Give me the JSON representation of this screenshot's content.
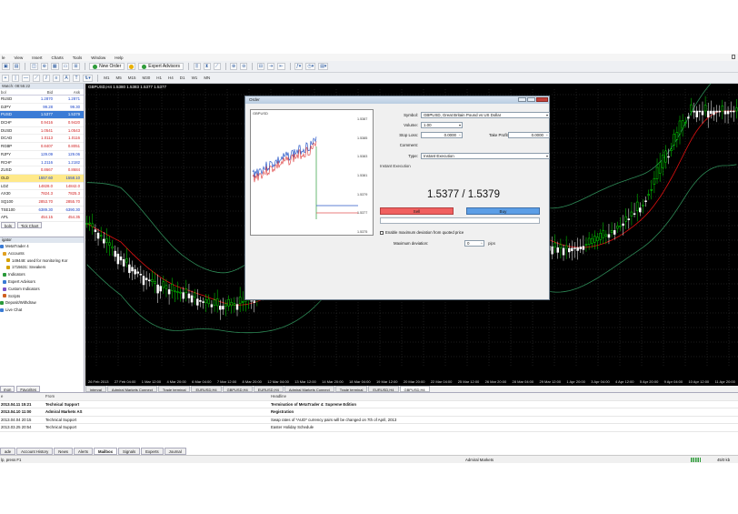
{
  "menu": [
    "le",
    "View",
    "Insert",
    "Charts",
    "Tools",
    "Window",
    "Help"
  ],
  "toolbar": {
    "new_order": "New Order",
    "expert_advisors": "Expert Advisors",
    "timeframes": [
      "M1",
      "M5",
      "M15",
      "M30",
      "H1",
      "H4",
      "D1",
      "W1",
      "MN"
    ]
  },
  "market_watch": {
    "title": "Watch: 08:55:22",
    "headers": {
      "symbol": "bol",
      "bid": "Bid",
      "ask": "Ask"
    },
    "rows": [
      {
        "symbol": "RUSD",
        "bid": "1.2870",
        "ask": "1.2871",
        "dir": "blue",
        "cls": ""
      },
      {
        "symbol": "DJPY",
        "bid": "99.28",
        "ask": "99.30",
        "dir": "blue",
        "cls": ""
      },
      {
        "symbol": "PUSD",
        "bid": "1.5377",
        "ask": "1.5379",
        "dir": "blue",
        "cls": "sel"
      },
      {
        "symbol": "DCHF",
        "bid": "0.9416",
        "ask": "0.9420",
        "dir": "red",
        "cls": ""
      },
      {
        "symbol": "DUSD",
        "bid": "1.0541",
        "ask": "1.0543",
        "dir": "red",
        "cls": ""
      },
      {
        "symbol": "DCAD",
        "bid": "1.0113",
        "ask": "1.0116",
        "dir": "red",
        "cls": ""
      },
      {
        "symbol": "RGBP",
        "bid": "0.8407",
        "ask": "0.8051",
        "dir": "red",
        "cls": ""
      },
      {
        "symbol": "RJPY",
        "bid": "129.09",
        "ask": "129.06",
        "dir": "blue",
        "cls": ""
      },
      {
        "symbol": "RCHF",
        "bid": "1.2116",
        "ask": "1.2182",
        "dir": "blue",
        "cls": ""
      },
      {
        "symbol": "ZUSD",
        "bid": "0.8667",
        "ask": "0.8684",
        "dir": "red",
        "cls": ""
      },
      {
        "symbol": "OLD",
        "bid": "1557.60",
        "ask": "1558.10",
        "dir": "blue",
        "cls": "gold"
      },
      {
        "symbol": "LDZ",
        "bid": "14828.0",
        "ask": "14842.0",
        "dir": "red",
        "cls": ""
      },
      {
        "symbol": "AX30",
        "bid": "7824.3",
        "ask": "7825.3",
        "dir": "red",
        "cls": ""
      },
      {
        "symbol": "SQ100",
        "bid": "2853.70",
        "ask": "2855.70",
        "dir": "red",
        "cls": ""
      },
      {
        "symbol": "TSE100",
        "bid": "6389.30",
        "ask": "6390.30",
        "dir": "blue",
        "cls": ""
      },
      {
        "symbol": "APL",
        "bid": "454.15",
        "ask": "454.35",
        "dir": "red",
        "cls": ""
      }
    ],
    "tabs": [
      "bols",
      "Tick Chart"
    ]
  },
  "navigator": {
    "title": "igator",
    "items": [
      {
        "label": "MetaTrader 4",
        "color": "#3a7bd5",
        "indent": 0
      },
      {
        "label": "Accounts",
        "color": "#e0a020",
        "indent": 3
      },
      {
        "label": "149448: used for monitoring Kor",
        "color": "#d4a000",
        "indent": 7
      },
      {
        "label": "1715631: Sneakers",
        "color": "#d4a000",
        "indent": 7
      },
      {
        "label": "Indicators",
        "color": "#2a9a3a",
        "indent": 3
      },
      {
        "label": "Expert Advisors",
        "color": "#3a7bd5",
        "indent": 3
      },
      {
        "label": "Custom Indicators",
        "color": "#7a52c8",
        "indent": 3
      },
      {
        "label": "Scripts",
        "color": "#d06020",
        "indent": 3
      },
      {
        "label": "Deposit/Withdraw",
        "color": "#2a9a3a",
        "indent": 0
      },
      {
        "label": "Live Chat",
        "color": "#3a7bd5",
        "indent": 0
      }
    ],
    "tabs": [
      "mon",
      "Favorites"
    ]
  },
  "chart": {
    "title": "GBPUSD,H4  1.5380 1.5383 1.5377 1.5377",
    "x_labels": [
      "26 Feb 2013",
      "27 Feb 04:00",
      "1 Mar 12:00",
      "4 Mar 20:00",
      "6 Mar 04:00",
      "7 Mar 12:00",
      "8 Mar 20:00",
      "12 Mar 04:00",
      "13 Mar 12:00",
      "14 Mar 20:00",
      "18 Mar 04:00",
      "19 Mar 12:00",
      "20 Mar 20:00",
      "22 Mar 04:00",
      "25 Mar 12:00",
      "26 Mar 20:00",
      "28 Mar 04:00",
      "29 Mar 12:00",
      "1 Apr 20:00",
      "3 Apr 04:00",
      "4 Apr 12:00",
      "5 Apr 20:00",
      "9 Apr 04:00",
      "10 Apr 12:00",
      "11 Apr 20:00"
    ],
    "tabs": [
      {
        "label": "interval",
        "active": false
      },
      {
        "label": "Admiral Markets Connect",
        "active": false
      },
      {
        "label": "Trade terminal",
        "active": false
      },
      {
        "label": "EURUSD,H4",
        "active": false
      },
      {
        "label": "GBPUSD,H4",
        "active": false
      },
      {
        "label": "EURUSD,H4",
        "active": false
      },
      {
        "label": "Admiral Markets Connect",
        "active": false
      },
      {
        "label": "Trade terminal",
        "active": false
      },
      {
        "label": "EURUSD,H4",
        "active": false
      },
      {
        "label": "GBPUSD,H4",
        "active": true
      }
    ]
  },
  "order_dialog": {
    "title": "Order",
    "mini_chart_title": "GBPUSD",
    "mini_axis": [
      "1.5387",
      "1.5385",
      "1.5383",
      "1.5381",
      "1.5379",
      "1.5377",
      "1.5375"
    ],
    "symbol_label": "Symbol:",
    "symbol_value": "GBPUSD, Great Britain Pound vs US Dollar",
    "volume_label": "Volume:",
    "volume_value": "1.00",
    "stoploss_label": "Stop Loss:",
    "stoploss_value": "0.0000",
    "takeprofit_label": "Take Profit:",
    "takeprofit_value": "0.0000",
    "comment_label": "Comment:",
    "type_label": "Type:",
    "type_value": "Instant Execution",
    "section_label": "Instant Execution",
    "price": "1.5377 / 1.5379",
    "sell_label": "Sell",
    "buy_label": "Buy",
    "deviation_check": "Enable maximum deviation from quoted price",
    "deviation_label": "Maximum deviation:",
    "deviation_value": "0",
    "deviation_unit": "pips"
  },
  "terminal": {
    "headers": {
      "time": "e",
      "from": "From",
      "headline": "Headline"
    },
    "rows": [
      {
        "time": "2013.04.11 15:21",
        "from": "Technical Support",
        "headline": "Termination of MetaTrader 4: Supreme Edition",
        "bold": true
      },
      {
        "time": "2013.04.10 11:00",
        "from": "Admiral Markets AS",
        "headline": "Registration",
        "bold": true
      },
      {
        "time": "2013.04.04 20:15",
        "from": "Technical Support",
        "headline": "Swap rates of *AUD* currency pairs will be changed on 7th of April, 2013",
        "bold": false
      },
      {
        "time": "2013.03.25 20:54",
        "from": "Technical Support",
        "headline": "Easter Holiday Schedule",
        "bold": false
      }
    ],
    "tabs": [
      {
        "label": "ade",
        "active": false
      },
      {
        "label": "Account History",
        "active": false
      },
      {
        "label": "News",
        "active": false
      },
      {
        "label": "Alerts",
        "active": false
      },
      {
        "label": "Mailbox",
        "active": true
      },
      {
        "label": "Signals",
        "active": false
      },
      {
        "label": "Experts",
        "active": false
      },
      {
        "label": "Journal",
        "active": false
      }
    ]
  },
  "status": {
    "help": "lp, press F1",
    "profile": "Admiral Markets",
    "traffic": "45/0 kb"
  },
  "colors": {
    "chart_bg": "#000000",
    "bull_candle": "#00e000",
    "bear_candle": "#ffffff",
    "bands": "#2e8b57",
    "ma_red": "#e01010",
    "sell_button": "#f06060",
    "buy_button": "#5c9ee6",
    "selected_row": "#3a7bd5"
  }
}
